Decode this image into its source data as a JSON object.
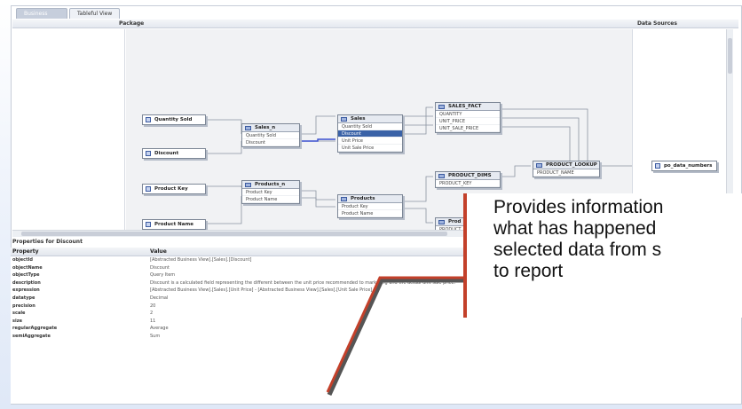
{
  "tabs": [
    {
      "label": "Business View"
    },
    {
      "label": "Tableful View"
    }
  ],
  "panes": {
    "package_label": "Package",
    "data_sources_label": "Data Sources"
  },
  "diagram": {
    "leaves": [
      {
        "label": "Quantity Sold"
      },
      {
        "label": "Discount"
      },
      {
        "label": "Product Key"
      },
      {
        "label": "Product Name"
      },
      {
        "label": "po_data_numbers"
      }
    ],
    "nodes": {
      "sales_n": {
        "title": "Sales_n",
        "rows": [
          "Quantity Sold",
          "Discount"
        ]
      },
      "sales": {
        "title": "Sales",
        "rows": [
          "Quantity Sold",
          "Discount",
          "Unit Price",
          "Unit Sale Price"
        ],
        "selected_index": 1
      },
      "sales_fact": {
        "title": "SALES_FACT",
        "rows": [
          "QUANTITY",
          "UNIT_PRICE",
          "UNIT_SALE_PRICE"
        ]
      },
      "products_n": {
        "title": "Products_n",
        "rows": [
          "Product Key",
          "Product Name"
        ]
      },
      "products": {
        "title": "Products",
        "rows": [
          "Product Key",
          "Product Name"
        ]
      },
      "product_dims": {
        "title": "PRODUCT_DIMS",
        "rows": [
          "PRODUCT_KEY"
        ]
      },
      "product_lookup": {
        "title": "PRODUCT_LOOKUP",
        "rows": [
          "PRODUCT_NAME"
        ]
      },
      "product_partial": {
        "title": "Prod",
        "rows": [
          "PRODUCT"
        ]
      }
    }
  },
  "properties": {
    "title": "Properties for Discount",
    "col_property": "Property",
    "col_value": "Value",
    "rows": [
      {
        "key": "objectId",
        "value": "[Abstracted Business View].[Sales].[Discount]"
      },
      {
        "key": "objectName",
        "value": "Discount"
      },
      {
        "key": "objectType",
        "value": "Query Item"
      },
      {
        "key": "description",
        "value": "Discount is a calculated field representing the different between the unit price recommended to marketing and the actual unit sale price."
      },
      {
        "key": "expression",
        "value": "[Abstracted Business View].[Sales].[Unit Price] - [Abstracted Business View].[Sales].[Unit Sale Price]"
      },
      {
        "key": "datatype",
        "value": "Decimal"
      },
      {
        "key": "precision",
        "value": "20"
      },
      {
        "key": "scale",
        "value": "2"
      },
      {
        "key": "size",
        "value": "11"
      },
      {
        "key": "regularAggregate",
        "value": "Average"
      },
      {
        "key": "semiAggregate",
        "value": "Sum"
      }
    ]
  },
  "callout": {
    "line1": "Provides information",
    "line2": "what has happened",
    "line3": "selected data from s",
    "line4": "to report"
  },
  "colors": {
    "accent": "#3a62a7",
    "callout_border": "#c3402a"
  }
}
